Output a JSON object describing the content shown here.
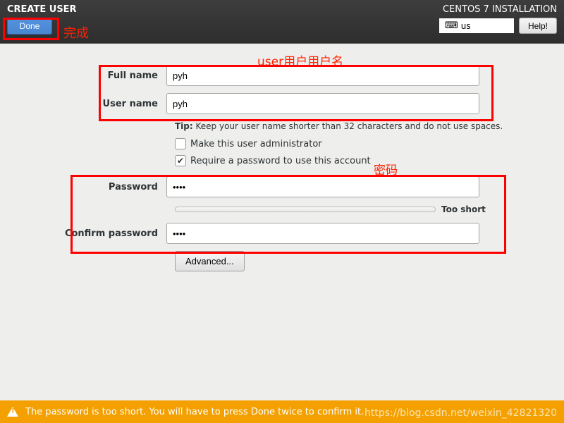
{
  "header": {
    "title": "CREATE USER",
    "subtitle": "CENTOS 7 INSTALLATION",
    "done_label": "Done",
    "help_label": "Help!",
    "keyboard_layout": "us"
  },
  "annotations": {
    "done_text": "完成",
    "user_text": "user用户用户名",
    "password_text": "密码"
  },
  "form": {
    "fullname_label": "Full name",
    "fullname_value": "pyh",
    "username_label": "User name",
    "username_value": "pyh",
    "tip_prefix": "Tip:",
    "tip_text": " Keep your user name shorter than 32 characters and do not use spaces.",
    "admin_checkbox_label": "Make this user administrator",
    "admin_checked": false,
    "require_password_label": "Require a password to use this account",
    "require_password_checked": true,
    "password_label": "Password",
    "password_value": "••••",
    "strength_label": "Too short",
    "confirm_label": "Confirm password",
    "confirm_value": "••••",
    "advanced_label": "Advanced..."
  },
  "warning": {
    "text": "The password is too short. You will have to press Done twice to confirm it."
  },
  "watermark": "https://blog.csdn.net/weixin_42821320"
}
